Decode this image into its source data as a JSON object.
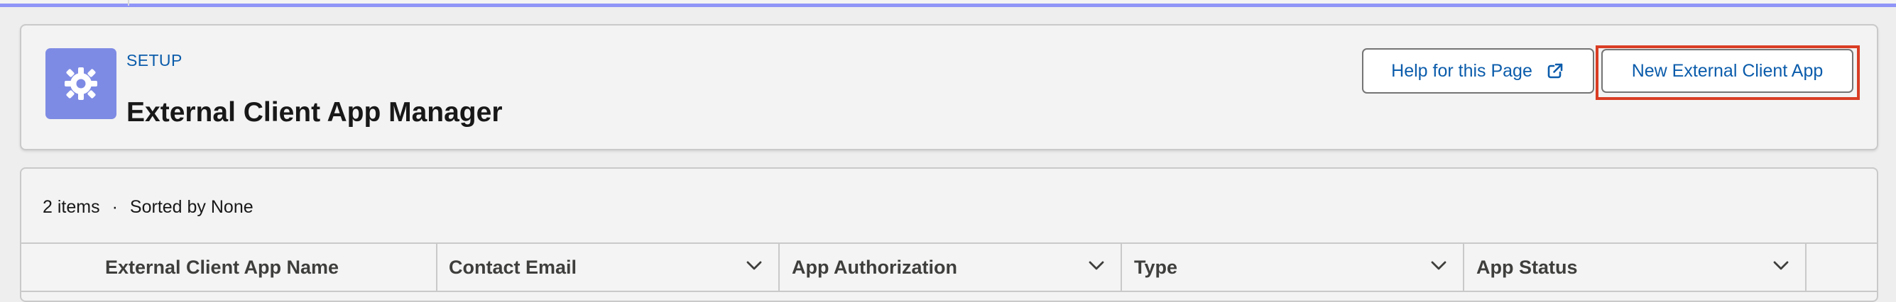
{
  "header": {
    "eyebrow": "SETUP",
    "title": "External Client App Manager",
    "actions": {
      "help_label": "Help for this Page",
      "new_app_label": "New External Client App"
    }
  },
  "list": {
    "count_text": "2 items",
    "separator": "·",
    "sort_text": "Sorted by None",
    "columns": [
      {
        "label": "External Client App Name"
      },
      {
        "label": "Contact Email"
      },
      {
        "label": "App Authorization"
      },
      {
        "label": "Type"
      },
      {
        "label": "App Status"
      }
    ]
  },
  "icons": {
    "setup": "gear-icon",
    "external_link": "external-link-icon",
    "column_menu": "chevron-down-icon"
  },
  "colors": {
    "accent": "#8f95f7",
    "setup_tile": "#7e8be4",
    "link_blue": "#0b5cab",
    "highlight": "#d93d24",
    "page_background": "#eeeeee",
    "card_background": "#f3f3f3"
  }
}
